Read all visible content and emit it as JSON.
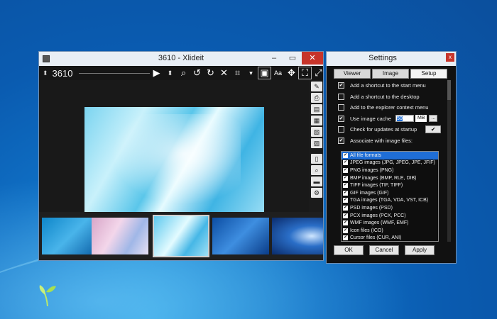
{
  "viewer": {
    "title": "3610 - Xlideit",
    "window_buttons": [
      "–",
      "▭",
      "✕"
    ],
    "image_number": "3610",
    "spin_icon": "updown-arrows-icon",
    "toolbar_icons": [
      "play-icon",
      "updown-arrows-icon",
      "search-icon",
      "rotate-left-icon",
      "rotate-right-icon",
      "close-icon",
      "crop-icon",
      "dropdown-icon",
      "fit-icon",
      "text-icon",
      "move-icon",
      "fullscreen-icon",
      "restore-icon"
    ],
    "side_icons": [
      "edit-icon",
      "print-icon",
      "save-icon",
      "slideshow-icon",
      "image-icon",
      "browse-icon",
      "page-icon",
      "zoom-icon",
      "folder-icon",
      "settings-icon"
    ]
  },
  "settings": {
    "title": "Settings",
    "close_label": "x",
    "tabs": [
      "Viewer",
      "Image",
      "Setup"
    ],
    "options": [
      {
        "label": "Add a shortcut to the start menu",
        "checked": true
      },
      {
        "label": "Add a shortcut to the desktop",
        "checked": false
      },
      {
        "label": "Add to the explorer context menu",
        "checked": false
      },
      {
        "label": "Use image cache",
        "checked": true
      },
      {
        "label": "Check for updates at startup",
        "checked": false
      },
      {
        "label": "Associate with image files:",
        "checked": true
      }
    ],
    "cache_value": "50",
    "cache_unit": "MB",
    "more_label": "...",
    "update_button": "✔",
    "formats": [
      "All file formats",
      "JPEG images (JPG, JPEG, JPE, JFIF)",
      "PNG images (PNG)",
      "BMP images (BMP, RLE, DIB)",
      "TIFF images (TIF, TIFF)",
      "GIF images (GIF)",
      "TGA images (TGA, VDA, VST, ICB)",
      "PSD images (PSD)",
      "PCX images (PCX, PCC)",
      "WMF images (WMF, EMF)",
      "Icon files (ICO)",
      "Cursor files (CUR, ANI)"
    ],
    "buttons": {
      "ok": "OK",
      "cancel": "Cancel",
      "apply": "Apply"
    }
  }
}
